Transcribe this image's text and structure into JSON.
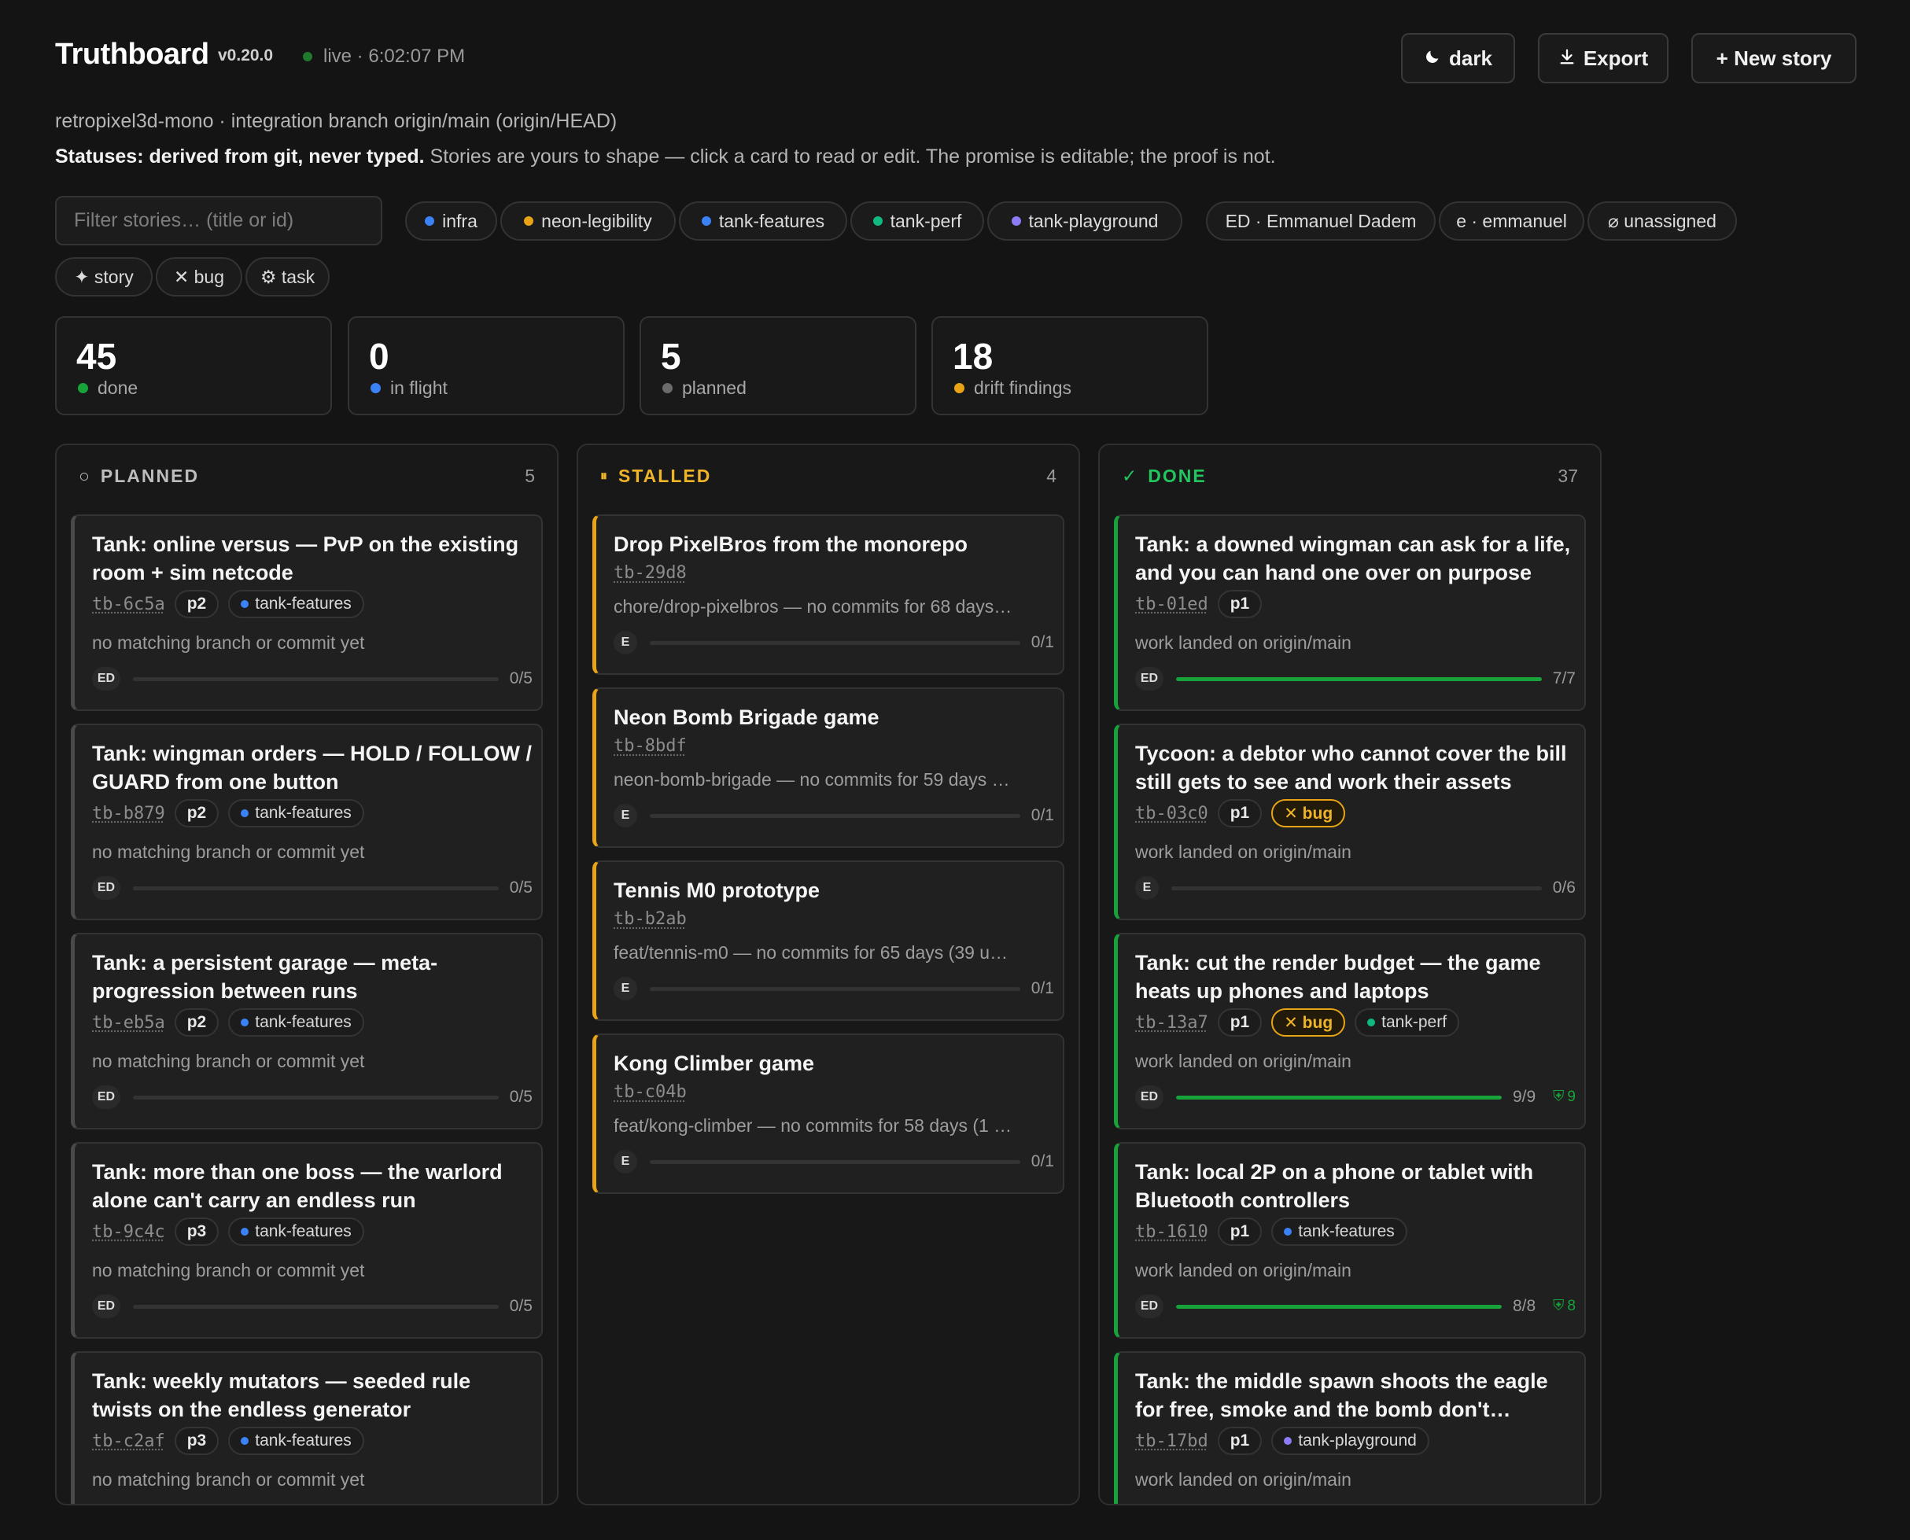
{
  "header": {
    "title": "Truthboard",
    "version": "v0.20.0",
    "live": "live · 6:02:07 PM",
    "buttons": {
      "dark": "dark",
      "export": "Export",
      "new_story": "+ New story"
    },
    "repo_line": "retropixel3d-mono · integration branch origin/main (origin/HEAD)",
    "statuses_bold": "Statuses: derived from git, never typed.",
    "statuses_rest": " Stories are yours to shape — click a card to read or edit. The promise is editable; the proof is not."
  },
  "filter": {
    "placeholder": "Filter stories… (title or id)",
    "value": "",
    "epics": [
      {
        "label": "infra",
        "color": "#3b82f6"
      },
      {
        "label": "neon-legibility",
        "color": "#e8a317"
      },
      {
        "label": "tank-features",
        "color": "#3b82f6"
      },
      {
        "label": "tank-perf",
        "color": "#10b981"
      },
      {
        "label": "tank-playground",
        "color": "#8b7cf6"
      }
    ],
    "owners": [
      "ED · Emmanuel Dadem",
      "e · emmanuel",
      "⌀ unassigned"
    ],
    "types": [
      "✦ story",
      "✕ bug",
      "⚙ task"
    ]
  },
  "stats": [
    {
      "value": "45",
      "label": "done",
      "color": "#17a33a"
    },
    {
      "value": "0",
      "label": "in flight",
      "color": "#3b82f6"
    },
    {
      "value": "5",
      "label": "planned",
      "color": "#6b6b6b"
    },
    {
      "value": "18",
      "label": "drift findings",
      "color": "#e8a317"
    }
  ],
  "columns": {
    "planned": {
      "icon": "○",
      "title": "PLANNED",
      "count": "5",
      "color": "#bdbdbd"
    },
    "stalled": {
      "icon": "⏸",
      "title": "STALLED",
      "count": "4",
      "color": "#f0b429"
    },
    "done": {
      "icon": "✓",
      "title": "DONE",
      "count": "37",
      "color": "#22c55e"
    }
  },
  "cards": {
    "planned": [
      {
        "title": "Tank: online versus — PvP on the existing room + sim netcode",
        "id": "tb-6c5a",
        "priority": "p2",
        "epic": "tank-features",
        "epic_color": "#3b82f6",
        "status": "no matching branch or commit yet",
        "owner": "ED",
        "progress": "0/5",
        "fraction": 0
      },
      {
        "title": "Tank: wingman orders — HOLD / FOLLOW / GUARD from one button",
        "id": "tb-b879",
        "priority": "p2",
        "epic": "tank-features",
        "epic_color": "#3b82f6",
        "status": "no matching branch or commit yet",
        "owner": "ED",
        "progress": "0/5",
        "fraction": 0
      },
      {
        "title": "Tank: a persistent garage — meta-progression between runs",
        "id": "tb-eb5a",
        "priority": "p2",
        "epic": "tank-features",
        "epic_color": "#3b82f6",
        "status": "no matching branch or commit yet",
        "owner": "ED",
        "progress": "0/5",
        "fraction": 0
      },
      {
        "title": "Tank: more than one boss — the warlord alone can't carry an endless run",
        "id": "tb-9c4c",
        "priority": "p3",
        "epic": "tank-features",
        "epic_color": "#3b82f6",
        "status": "no matching branch or commit yet",
        "owner": "ED",
        "progress": "0/5",
        "fraction": 0
      },
      {
        "title": "Tank: weekly mutators — seeded rule twists on the endless generator",
        "id": "tb-c2af",
        "priority": "p3",
        "epic": "tank-features",
        "epic_color": "#3b82f6",
        "status": "no matching branch or commit yet"
      }
    ],
    "stalled": [
      {
        "title": "Drop PixelBros from the monorepo",
        "id": "tb-29d8",
        "status": "chore/drop-pixelbros — no commits for 68 days…",
        "owner": "E",
        "progress": "0/1"
      },
      {
        "title": "Neon Bomb Brigade game",
        "id": "tb-8bdf",
        "status": "neon-bomb-brigade — no commits for 59 days …",
        "owner": "E",
        "progress": "0/1"
      },
      {
        "title": "Tennis M0 prototype",
        "id": "tb-b2ab",
        "status": "feat/tennis-m0 — no commits for 65 days (39 u…",
        "owner": "E",
        "progress": "0/1"
      },
      {
        "title": "Kong Climber game",
        "id": "tb-c04b",
        "status": "feat/kong-climber — no commits for 58 days (1 …",
        "owner": "E",
        "progress": "0/1"
      }
    ],
    "done": [
      {
        "title": "Tank: a downed wingman can ask for a life, and you can hand one over on purpose",
        "id": "tb-01ed",
        "priority": "p1",
        "status": "work landed on origin/main",
        "owner": "ED",
        "progress": "7/7",
        "fraction": 1
      },
      {
        "title": "Tycoon: a debtor who cannot cover the bill still gets to see and work their assets",
        "id": "tb-03c0",
        "priority": "p1",
        "bug": "✕ bug",
        "status": "work landed on origin/main",
        "owner": "E",
        "progress": "0/6",
        "fraction": 0
      },
      {
        "title": "Tank: cut the render budget — the game heats up phones and laptops",
        "id": "tb-13a7",
        "priority": "p1",
        "bug": "✕ bug",
        "epic": "tank-perf",
        "epic_color": "#10b981",
        "status": "work landed on origin/main",
        "owner": "ED",
        "progress": "9/9",
        "fraction": 1,
        "shield": "9"
      },
      {
        "title": "Tank: local 2P on a phone or tablet with Bluetooth controllers",
        "id": "tb-1610",
        "priority": "p1",
        "epic": "tank-features",
        "epic_color": "#3b82f6",
        "status": "work landed on origin/main",
        "owner": "ED",
        "progress": "8/8",
        "fraction": 1,
        "shield": "8"
      },
      {
        "title": "Tank: the middle spawn shoots the eagle for free, smoke and the bomb don't…",
        "id": "tb-17bd",
        "priority": "p1",
        "epic": "tank-playground",
        "epic_color": "#8b7cf6",
        "status": "work landed on origin/main"
      }
    ]
  }
}
